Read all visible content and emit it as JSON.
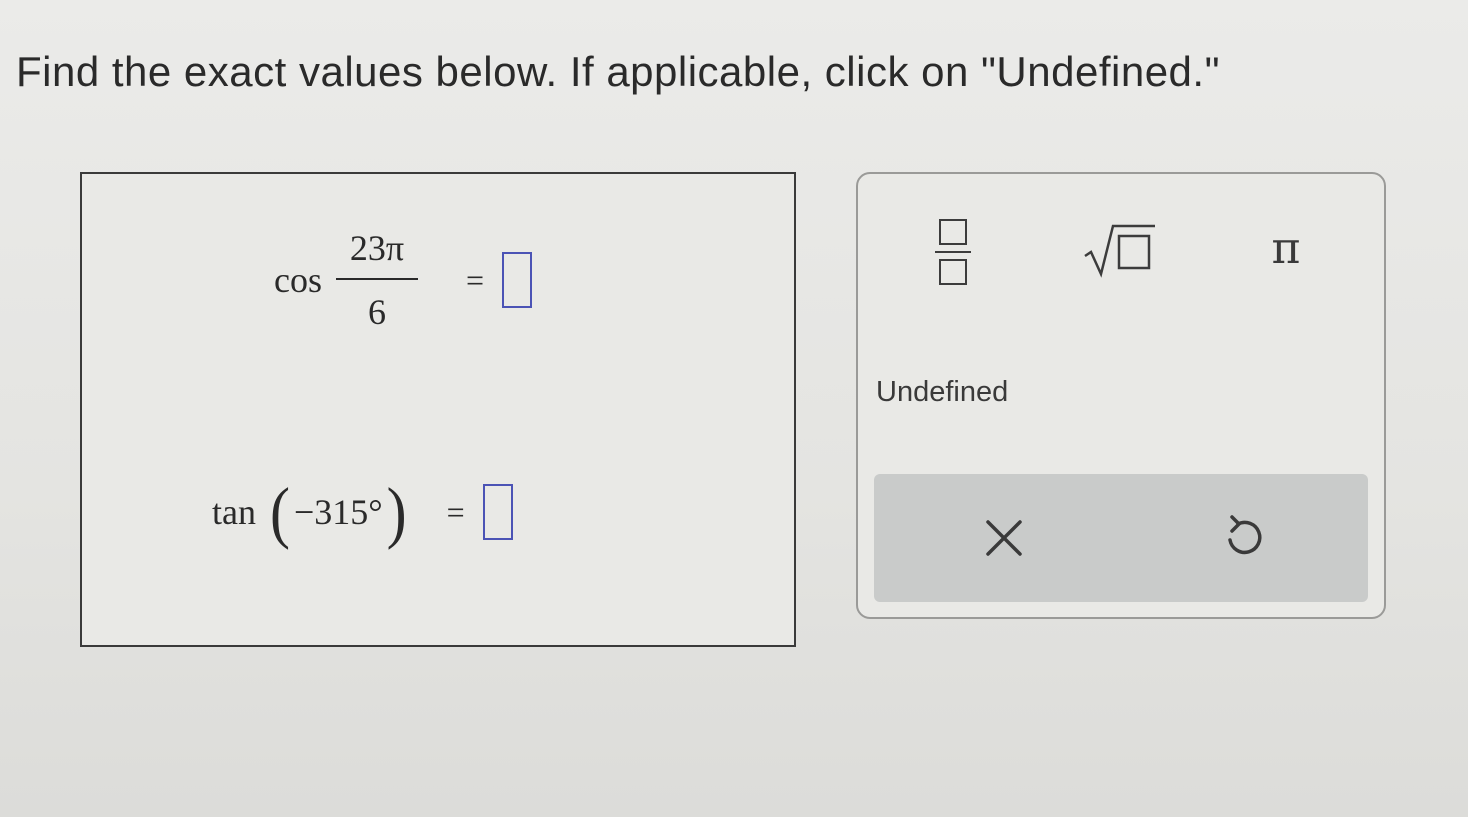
{
  "instructions": "Find the exact values below. If applicable, click on \"Undefined.\"",
  "problems": [
    {
      "function": "cos",
      "numerator": "23π",
      "denominator": "6",
      "equals": "="
    },
    {
      "function": "tan",
      "open_paren": "(",
      "argument": "−315°",
      "close_paren": ")",
      "equals": "="
    }
  ],
  "palette": {
    "tools": [
      {
        "name": "fraction-icon"
      },
      {
        "name": "square-root-icon"
      },
      {
        "name": "pi-icon",
        "glyph": "π"
      }
    ],
    "undefined_label": "Undefined",
    "actions": [
      {
        "name": "clear-icon"
      },
      {
        "name": "undo-icon"
      }
    ]
  },
  "colors": {
    "answer_box_border": "#4b53b5",
    "action_bar_bg": "#c9cbca"
  }
}
